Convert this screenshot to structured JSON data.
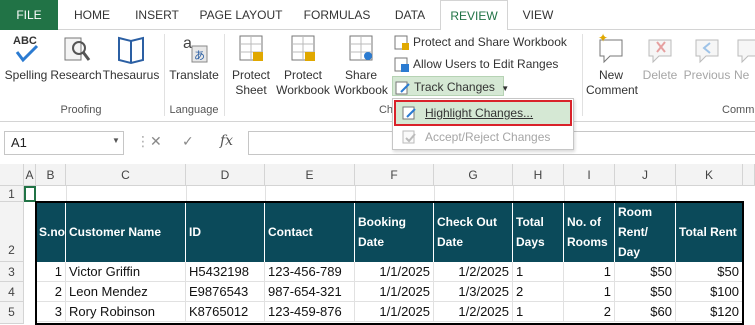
{
  "tabs": [
    "FILE",
    "HOME",
    "INSERT",
    "PAGE LAYOUT",
    "FORMULAS",
    "DATA",
    "REVIEW",
    "VIEW"
  ],
  "ribbon": {
    "proofing": {
      "spelling": "Spelling",
      "research": "Research",
      "thesaurus": "Thesaurus",
      "group": "Proofing"
    },
    "language": {
      "translate": "Translate",
      "group": "Language"
    },
    "changes": {
      "protect_sheet_1": "Protect",
      "protect_sheet_2": "Sheet",
      "protect_workbook_1": "Protect",
      "protect_workbook_2": "Workbook",
      "share_workbook_1": "Share",
      "share_workbook_2": "Workbook",
      "protect_and_share": "Protect and Share Workbook",
      "allow_users": "Allow Users to Edit Ranges",
      "track_changes": "Track Changes",
      "group": "Ch"
    },
    "comments": {
      "new_comment_1": "New",
      "new_comment_2": "Comment",
      "delete": "Delete",
      "previous": "Previous",
      "next": "Ne",
      "group": "Comm"
    }
  },
  "track_menu": {
    "highlight": "Highlight Changes...",
    "accept_reject": "Accept/Reject Changes"
  },
  "formula_bar": {
    "name_box": "A1",
    "fx": "fx",
    "value": ""
  },
  "columns": [
    "A",
    "B",
    "C",
    "D",
    "E",
    "F",
    "G",
    "H",
    "I",
    "J",
    "K"
  ],
  "rows": [
    "1",
    "2",
    "3",
    "4",
    "5"
  ],
  "table": {
    "headers": [
      "S.no",
      "Customer Name",
      "ID",
      "Contact",
      "Booking Date",
      "Check Out Date",
      "Total Days",
      "No. of Rooms",
      "Room Rent/ Day",
      "Total Rent"
    ],
    "rows": [
      [
        "1",
        "Victor Griffin",
        "H5432198",
        "123-456-789",
        "1/1/2025",
        "1/2/2025",
        "1",
        "1",
        "$50",
        "$50"
      ],
      [
        "2",
        "Leon Mendez",
        "E9876543",
        "987-654-321",
        "1/1/2025",
        "1/3/2025",
        "2",
        "1",
        "$50",
        "$100"
      ],
      [
        "3",
        "Rory Robinson",
        "K8765012",
        "123-459-876",
        "1/1/2025",
        "1/2/2025",
        "1",
        "2",
        "$60",
        "$120"
      ]
    ]
  },
  "colors": {
    "file_tab": "#217346",
    "table_header": "#0b4a5a",
    "highlight_outline": "#d9222a",
    "hover": "#d5e8d4"
  }
}
